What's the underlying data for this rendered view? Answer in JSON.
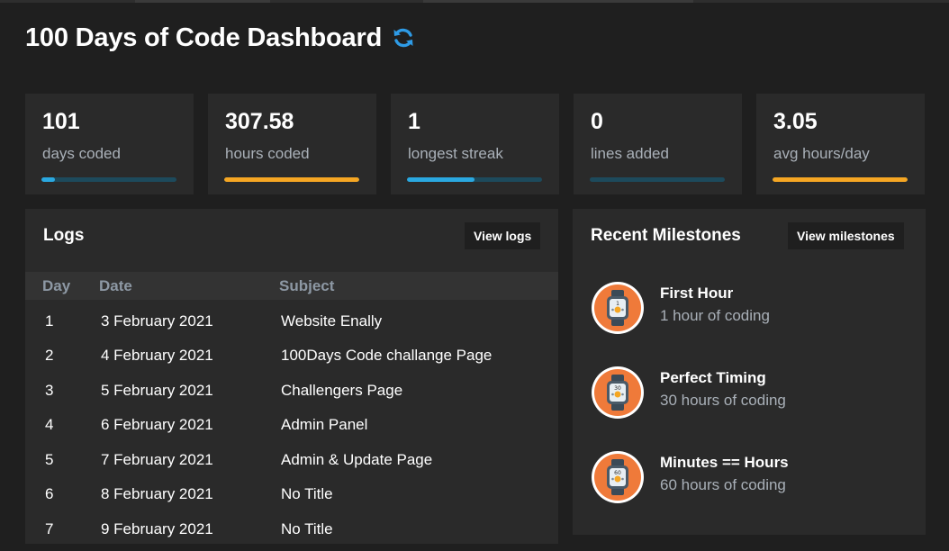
{
  "header": {
    "title": "100 Days of Code Dashboard",
    "refresh_icon": "refresh-icon"
  },
  "stats": [
    {
      "value": "101",
      "label": "days coded",
      "progress": 0.1,
      "color": "#2aa8e0",
      "track": "#1d4a5c"
    },
    {
      "value": "307.58",
      "label": "hours coded",
      "progress": 1.0,
      "color": "#f5a623",
      "track": "#1d4a5c"
    },
    {
      "value": "1",
      "label": "longest streak",
      "progress": 0.5,
      "color": "#2aa8e0",
      "track": "#1d4a5c"
    },
    {
      "value": "0",
      "label": "lines added",
      "progress": 0.0,
      "color": "#2aa8e0",
      "track": "#1d4a5c"
    },
    {
      "value": "3.05",
      "label": "avg hours/day",
      "progress": 1.0,
      "color": "#f5a623",
      "track": "#1d4a5c"
    }
  ],
  "logs": {
    "title": "Logs",
    "view_button": "View logs",
    "columns": {
      "day": "Day",
      "date": "Date",
      "subject": "Subject"
    },
    "rows": [
      {
        "day": "1",
        "date": "3 February 2021",
        "subject": "Website Enally"
      },
      {
        "day": "2",
        "date": "4 February 2021",
        "subject": "100Days Code challange Page"
      },
      {
        "day": "3",
        "date": "5 February 2021",
        "subject": "Challengers Page"
      },
      {
        "day": "4",
        "date": "6 February 2021",
        "subject": "Admin Panel"
      },
      {
        "day": "5",
        "date": "7 February 2021",
        "subject": "Admin & Update Page"
      },
      {
        "day": "6",
        "date": "8 February 2021",
        "subject": "No Title"
      },
      {
        "day": "7",
        "date": "9 February 2021",
        "subject": "No Title"
      }
    ]
  },
  "milestones": {
    "title": "Recent Milestones",
    "view_button": "View milestones",
    "items": [
      {
        "name": "First Hour",
        "desc": "1 hour of coding",
        "badge_text": "1",
        "icon": "stopwatch-icon"
      },
      {
        "name": "Perfect Timing",
        "desc": "30 hours of coding",
        "badge_text": "30",
        "icon": "stopwatch-icon"
      },
      {
        "name": "Minutes == Hours",
        "desc": "60 hours of coding",
        "badge_text": "60",
        "icon": "stopwatch-icon"
      }
    ]
  },
  "colors": {
    "accent_blue": "#2aa8e0",
    "accent_orange": "#f5a623",
    "panel": "#2a2a2a",
    "background": "#1f1f1f"
  }
}
